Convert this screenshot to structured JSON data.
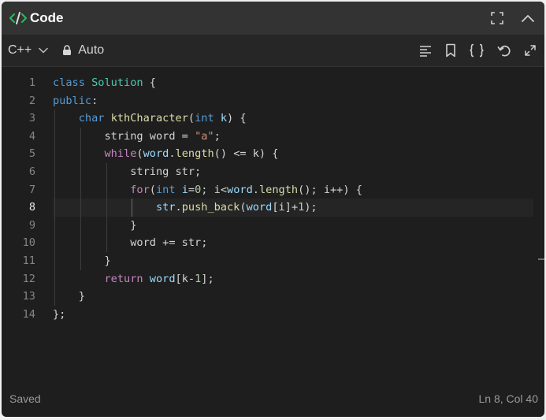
{
  "panel": {
    "title": "Code",
    "actions": [
      "expand-icon",
      "collapse-icon"
    ]
  },
  "toolbar": {
    "language": "C++",
    "mode": "Auto",
    "tools": [
      "format-icon",
      "bookmark-icon",
      "braces-icon",
      "reset-icon",
      "fullscreen-icon"
    ]
  },
  "editor": {
    "active_line": 8,
    "lines": [
      {
        "n": "1",
        "tokens": [
          {
            "c": "kw",
            "t": "class"
          },
          {
            "c": "pl",
            "t": " "
          },
          {
            "c": "type",
            "t": "Solution"
          },
          {
            "c": "pl",
            "t": " {"
          }
        ]
      },
      {
        "n": "2",
        "tokens": [
          {
            "c": "kw",
            "t": "public"
          },
          {
            "c": "pl",
            "t": ":"
          }
        ]
      },
      {
        "n": "3",
        "tokens": [
          {
            "c": "pl",
            "t": "    "
          },
          {
            "c": "kw",
            "t": "char"
          },
          {
            "c": "pl",
            "t": " "
          },
          {
            "c": "fn",
            "t": "kthCharacter"
          },
          {
            "c": "pl",
            "t": "("
          },
          {
            "c": "kw",
            "t": "int"
          },
          {
            "c": "pl",
            "t": " "
          },
          {
            "c": "var",
            "t": "k"
          },
          {
            "c": "pl",
            "t": ") {"
          }
        ]
      },
      {
        "n": "4",
        "tokens": [
          {
            "c": "pl",
            "t": "        string word = "
          },
          {
            "c": "str",
            "t": "\"a\""
          },
          {
            "c": "pl",
            "t": ";"
          }
        ]
      },
      {
        "n": "5",
        "tokens": [
          {
            "c": "pl",
            "t": "        "
          },
          {
            "c": "ctl",
            "t": "while"
          },
          {
            "c": "pl",
            "t": "("
          },
          {
            "c": "var",
            "t": "word"
          },
          {
            "c": "pl",
            "t": "."
          },
          {
            "c": "fn",
            "t": "length"
          },
          {
            "c": "pl",
            "t": "() <= k) {"
          }
        ]
      },
      {
        "n": "6",
        "tokens": [
          {
            "c": "pl",
            "t": "            string str;"
          }
        ]
      },
      {
        "n": "7",
        "tokens": [
          {
            "c": "pl",
            "t": "            "
          },
          {
            "c": "ctl",
            "t": "for"
          },
          {
            "c": "pl",
            "t": "("
          },
          {
            "c": "kw",
            "t": "int"
          },
          {
            "c": "pl",
            "t": " "
          },
          {
            "c": "var",
            "t": "i"
          },
          {
            "c": "pl",
            "t": "="
          },
          {
            "c": "num",
            "t": "0"
          },
          {
            "c": "pl",
            "t": "; i<"
          },
          {
            "c": "var",
            "t": "word"
          },
          {
            "c": "pl",
            "t": "."
          },
          {
            "c": "fn",
            "t": "length"
          },
          {
            "c": "pl",
            "t": "(); i++) {"
          }
        ]
      },
      {
        "n": "8",
        "tokens": [
          {
            "c": "pl",
            "t": "                "
          },
          {
            "c": "var",
            "t": "str"
          },
          {
            "c": "pl",
            "t": "."
          },
          {
            "c": "fn",
            "t": "push_back"
          },
          {
            "c": "pl",
            "t": "("
          },
          {
            "c": "var",
            "t": "word"
          },
          {
            "c": "pl",
            "t": "[i]+"
          },
          {
            "c": "num",
            "t": "1"
          },
          {
            "c": "pl",
            "t": ");"
          }
        ]
      },
      {
        "n": "9",
        "tokens": [
          {
            "c": "pl",
            "t": "            }"
          }
        ]
      },
      {
        "n": "10",
        "tokens": [
          {
            "c": "pl",
            "t": "            word += str;"
          }
        ]
      },
      {
        "n": "11",
        "tokens": [
          {
            "c": "pl",
            "t": "        }"
          }
        ]
      },
      {
        "n": "12",
        "tokens": [
          {
            "c": "pl",
            "t": "        "
          },
          {
            "c": "ctl",
            "t": "return"
          },
          {
            "c": "pl",
            "t": " "
          },
          {
            "c": "var",
            "t": "word"
          },
          {
            "c": "pl",
            "t": "[k-"
          },
          {
            "c": "num",
            "t": "1"
          },
          {
            "c": "pl",
            "t": "];"
          }
        ]
      },
      {
        "n": "13",
        "tokens": [
          {
            "c": "pl",
            "t": "    }"
          }
        ]
      },
      {
        "n": "14",
        "tokens": [
          {
            "c": "pl",
            "t": "};"
          }
        ]
      }
    ]
  },
  "status": {
    "saved": "Saved",
    "cursor": "Ln 8, Col 40"
  },
  "colors": {
    "keyword": "#569cd6",
    "control": "#c586c0",
    "type": "#4ec9b0",
    "function": "#dcdcaa",
    "variable": "#9cdcfe",
    "string": "#ce9178",
    "number": "#b5cea8",
    "logo": "#2cbb5d"
  }
}
